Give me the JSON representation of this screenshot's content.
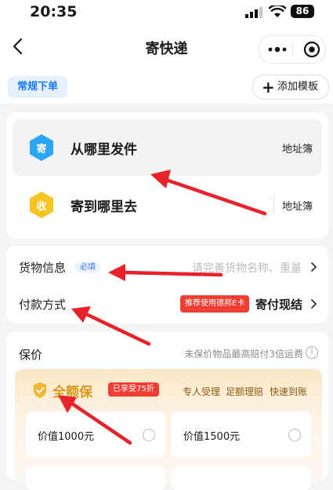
{
  "status_bar": {
    "time": "20:35",
    "battery": "86"
  },
  "nav": {
    "title": "寄快递"
  },
  "tabs": {
    "normal_order": "常规下单",
    "add_template": "添加模板"
  },
  "address": {
    "from": {
      "icon_char": "寄",
      "title": "从哪里发件",
      "address_book": "地址簿"
    },
    "to": {
      "icon_char": "收",
      "title": "寄到哪里去",
      "address_book": "地址簿"
    }
  },
  "cargo": {
    "label": "货物信息",
    "required": "必填",
    "placeholder": "请完善货物名称、重量"
  },
  "payment": {
    "label": "付款方式",
    "badge": "推荐使用德邦E卡",
    "value": "寄付现结"
  },
  "insurance": {
    "label": "保价",
    "description": "未保价物品最高赔付3倍运费",
    "full_title": "全额保",
    "discount_badge": "已享受75折",
    "perks": [
      "专人受理",
      "足额理赔",
      "快速到账"
    ],
    "options": [
      {
        "label": "价值1000元"
      },
      {
        "label": "价值1500元"
      }
    ]
  },
  "colors": {
    "accent_blue": "#1677ff",
    "from_icon": "#2aa6f5",
    "to_icon": "#f7c325",
    "badge_red": "#f03d33",
    "annotation_arrow": "#e8222a",
    "gold": "#d89a1b"
  },
  "icons": {
    "back": "chevron-left-icon",
    "more": "more-dots-icon",
    "target": "target-icon",
    "add": "plus-icon",
    "shield": "shield-icon",
    "info": "info-icon"
  }
}
